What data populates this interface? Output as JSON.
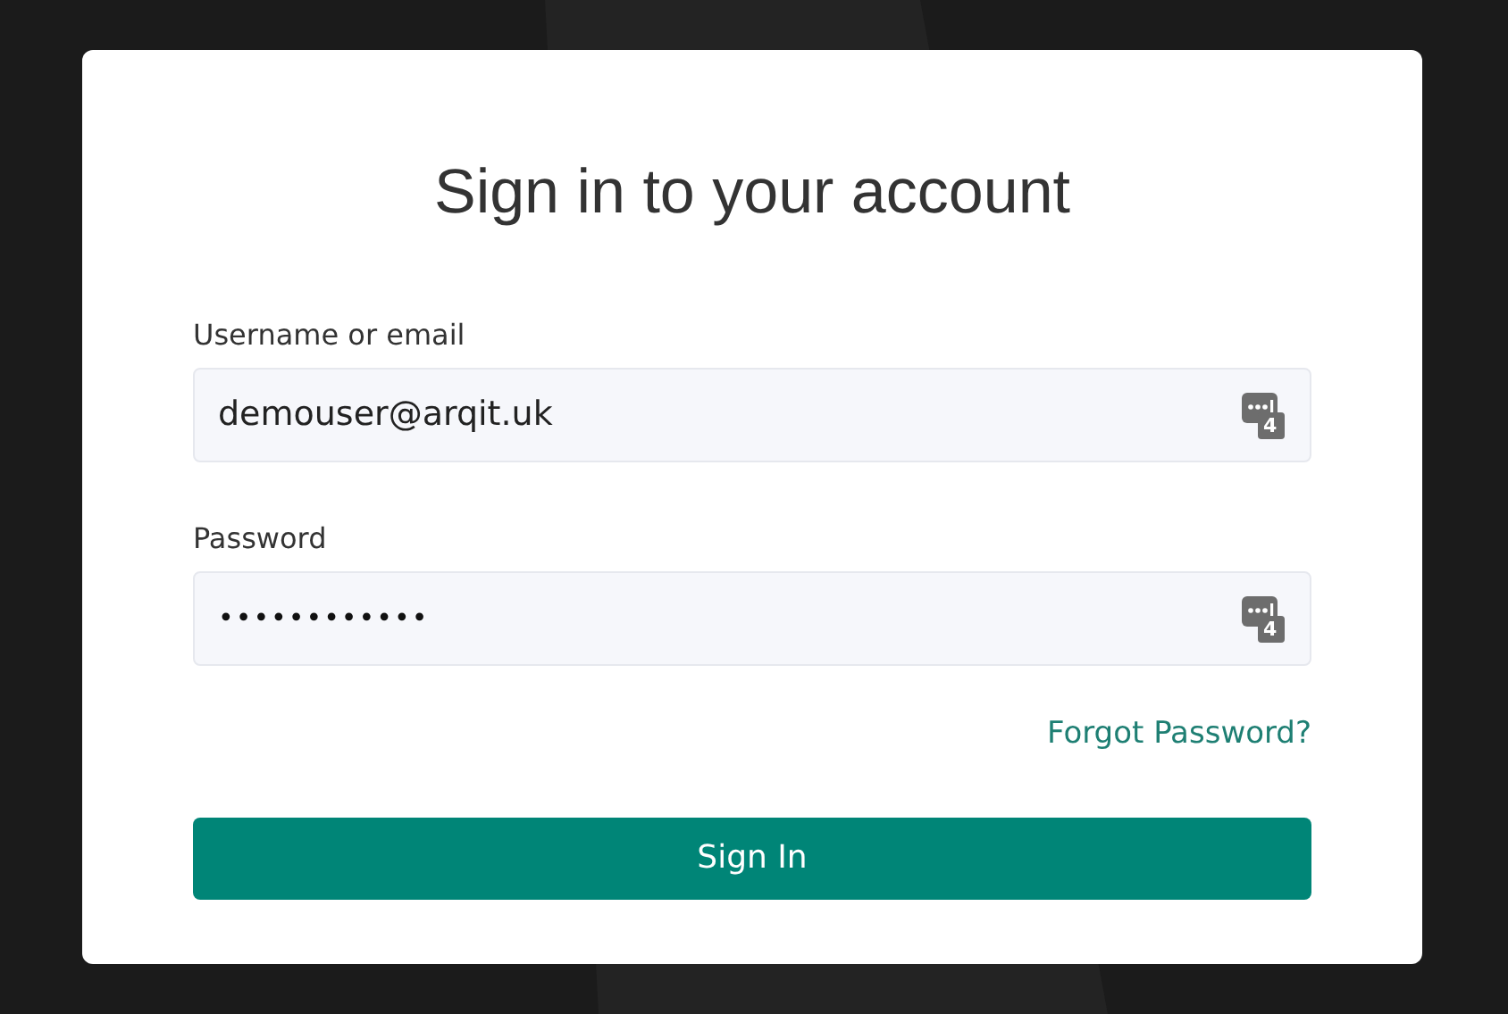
{
  "title": "Sign in to your account",
  "fields": [
    {
      "label": "Username or email",
      "value": "demouser@arqit.uk",
      "kind": "text",
      "badge": "4"
    },
    {
      "label": "Password",
      "value": "••••••••••••",
      "kind": "password",
      "badge": "4"
    }
  ],
  "forgot_link": "Forgot Password?",
  "submit_button": "Sign In"
}
